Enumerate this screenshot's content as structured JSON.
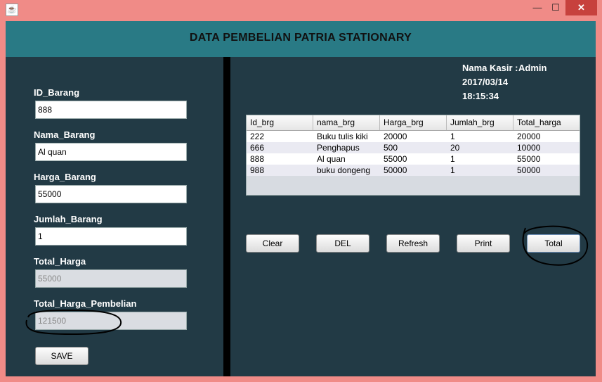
{
  "window": {
    "title_icon": "java-app-icon",
    "minimize": "—",
    "maximize": "☐",
    "close": "✕"
  },
  "header": {
    "title": "DATA PEMBELIAN PATRIA STATIONARY"
  },
  "form": {
    "id_label": "ID_Barang",
    "id_value": "888",
    "nama_label": "Nama_Barang",
    "nama_value": "Al quan",
    "harga_label": "Harga_Barang",
    "harga_value": "55000",
    "jumlah_label": "Jumlah_Barang",
    "jumlah_value": "1",
    "total_label": "Total_Harga",
    "total_value": "55000",
    "pembelian_label": "Total_Harga_Pembelian",
    "pembelian_value": "121500",
    "save_label": "SAVE"
  },
  "kasir": {
    "label": "Nama Kasir :",
    "name": "Admin",
    "date": "2017/03/14",
    "time": "18:15:34"
  },
  "table": {
    "columns": [
      "Id_brg",
      "nama_brg",
      "Harga_brg",
      "Jumlah_brg",
      "Total_harga"
    ],
    "rows": [
      [
        "222",
        "Buku tulis kiki",
        "20000",
        "1",
        "20000"
      ],
      [
        "666",
        "Penghapus",
        "500",
        "20",
        "10000"
      ],
      [
        "888",
        "Al quan",
        "55000",
        "1",
        "55000"
      ],
      [
        "988",
        "buku dongeng",
        "50000",
        "1",
        "50000"
      ]
    ]
  },
  "actions": {
    "clear": "Clear",
    "del": "DEL",
    "refresh": "Refresh",
    "print": "Print",
    "total": "Total"
  },
  "colors": {
    "frame": "#f08b87",
    "header": "#297a85",
    "panel": "#223a45",
    "divider": "#000000"
  }
}
